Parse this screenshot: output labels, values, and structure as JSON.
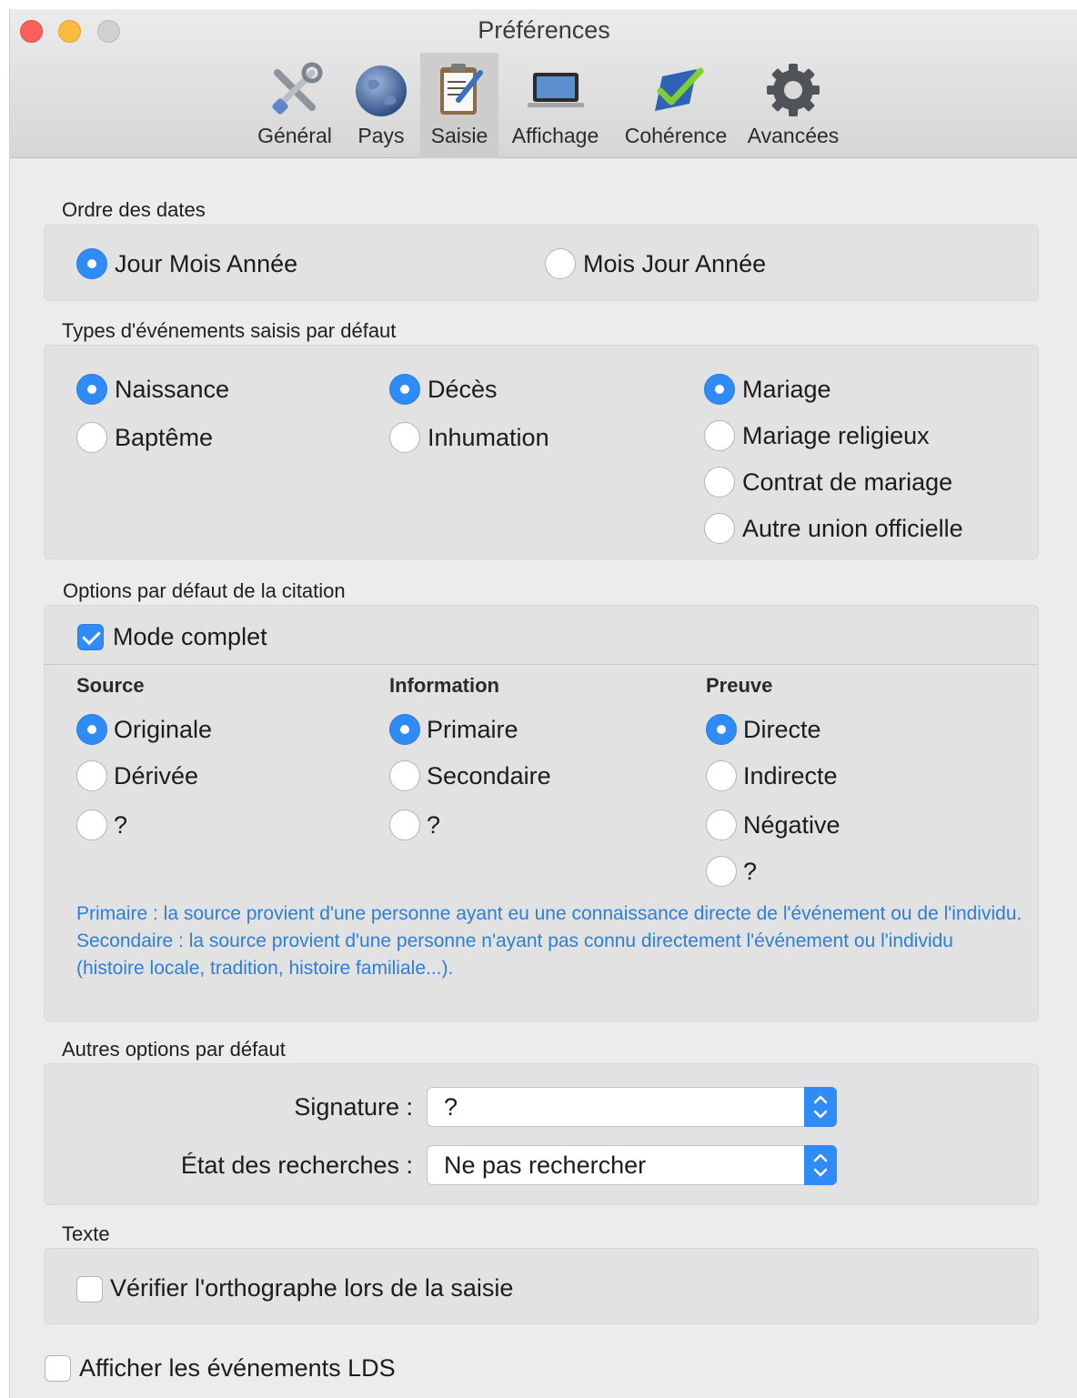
{
  "window": {
    "title": "Préférences"
  },
  "toolbar": {
    "items": [
      {
        "label": "Général",
        "icon": "tools-icon"
      },
      {
        "label": "Pays",
        "icon": "globe-icon"
      },
      {
        "label": "Saisie",
        "icon": "clipboard-pencil-icon",
        "selected": true
      },
      {
        "label": "Affichage",
        "icon": "laptop-icon"
      },
      {
        "label": "Cohérence",
        "icon": "checkmark-icon"
      },
      {
        "label": "Avancées",
        "icon": "gear-icon"
      }
    ]
  },
  "date_order": {
    "label": "Ordre des dates",
    "options": [
      {
        "label": "Jour Mois Année",
        "selected": true
      },
      {
        "label": "Mois Jour Année",
        "selected": false
      }
    ]
  },
  "event_types": {
    "label": "Types d'événements saisis par défaut",
    "items": [
      {
        "label": "Naissance",
        "selected": true
      },
      {
        "label": "Baptême",
        "selected": false
      },
      {
        "label": "Décès",
        "selected": true
      },
      {
        "label": "Inhumation",
        "selected": false
      },
      {
        "label": "Mariage",
        "selected": true
      },
      {
        "label": "Mariage religieux",
        "selected": false
      },
      {
        "label": "Contrat de mariage",
        "selected": false
      },
      {
        "label": "Autre union officielle",
        "selected": false
      }
    ]
  },
  "citation": {
    "label": "Options par défaut de la citation",
    "mode_complet": {
      "label": "Mode complet",
      "checked": true
    },
    "source": {
      "header": "Source",
      "options": [
        {
          "label": "Originale",
          "selected": true
        },
        {
          "label": "Dérivée",
          "selected": false
        },
        {
          "label": "?",
          "selected": false
        }
      ]
    },
    "information": {
      "header": "Information",
      "options": [
        {
          "label": "Primaire",
          "selected": true
        },
        {
          "label": "Secondaire",
          "selected": false
        },
        {
          "label": "?",
          "selected": false
        }
      ]
    },
    "preuve": {
      "header": "Preuve",
      "options": [
        {
          "label": "Directe",
          "selected": true
        },
        {
          "label": "Indirecte",
          "selected": false
        },
        {
          "label": "Négative",
          "selected": false
        },
        {
          "label": "?",
          "selected": false
        }
      ]
    },
    "help_primaire": "Primaire : la source provient d'une personne ayant eu une connaissance directe de l'événement ou de l'individu.",
    "help_secondaire": "Secondaire : la source provient d'une personne n'ayant pas connu directement l'événement ou l'individu (histoire locale, tradition, histoire familiale...)."
  },
  "other_defaults": {
    "label": "Autres options par défaut",
    "signature": {
      "label": "Signature :",
      "value": "?"
    },
    "research_state": {
      "label": "État des recherches :",
      "value": "Ne pas rechercher"
    }
  },
  "text": {
    "label": "Texte",
    "spellcheck": {
      "label": "Vérifier l'orthographe lors de la saisie",
      "checked": false
    }
  },
  "lds": {
    "label": "Afficher les événements LDS",
    "checked": false
  },
  "colors": {
    "accent": "#2f8bf5",
    "help_text": "#2c7fd8",
    "close": "#fc605c",
    "minimize": "#fdbc40"
  }
}
